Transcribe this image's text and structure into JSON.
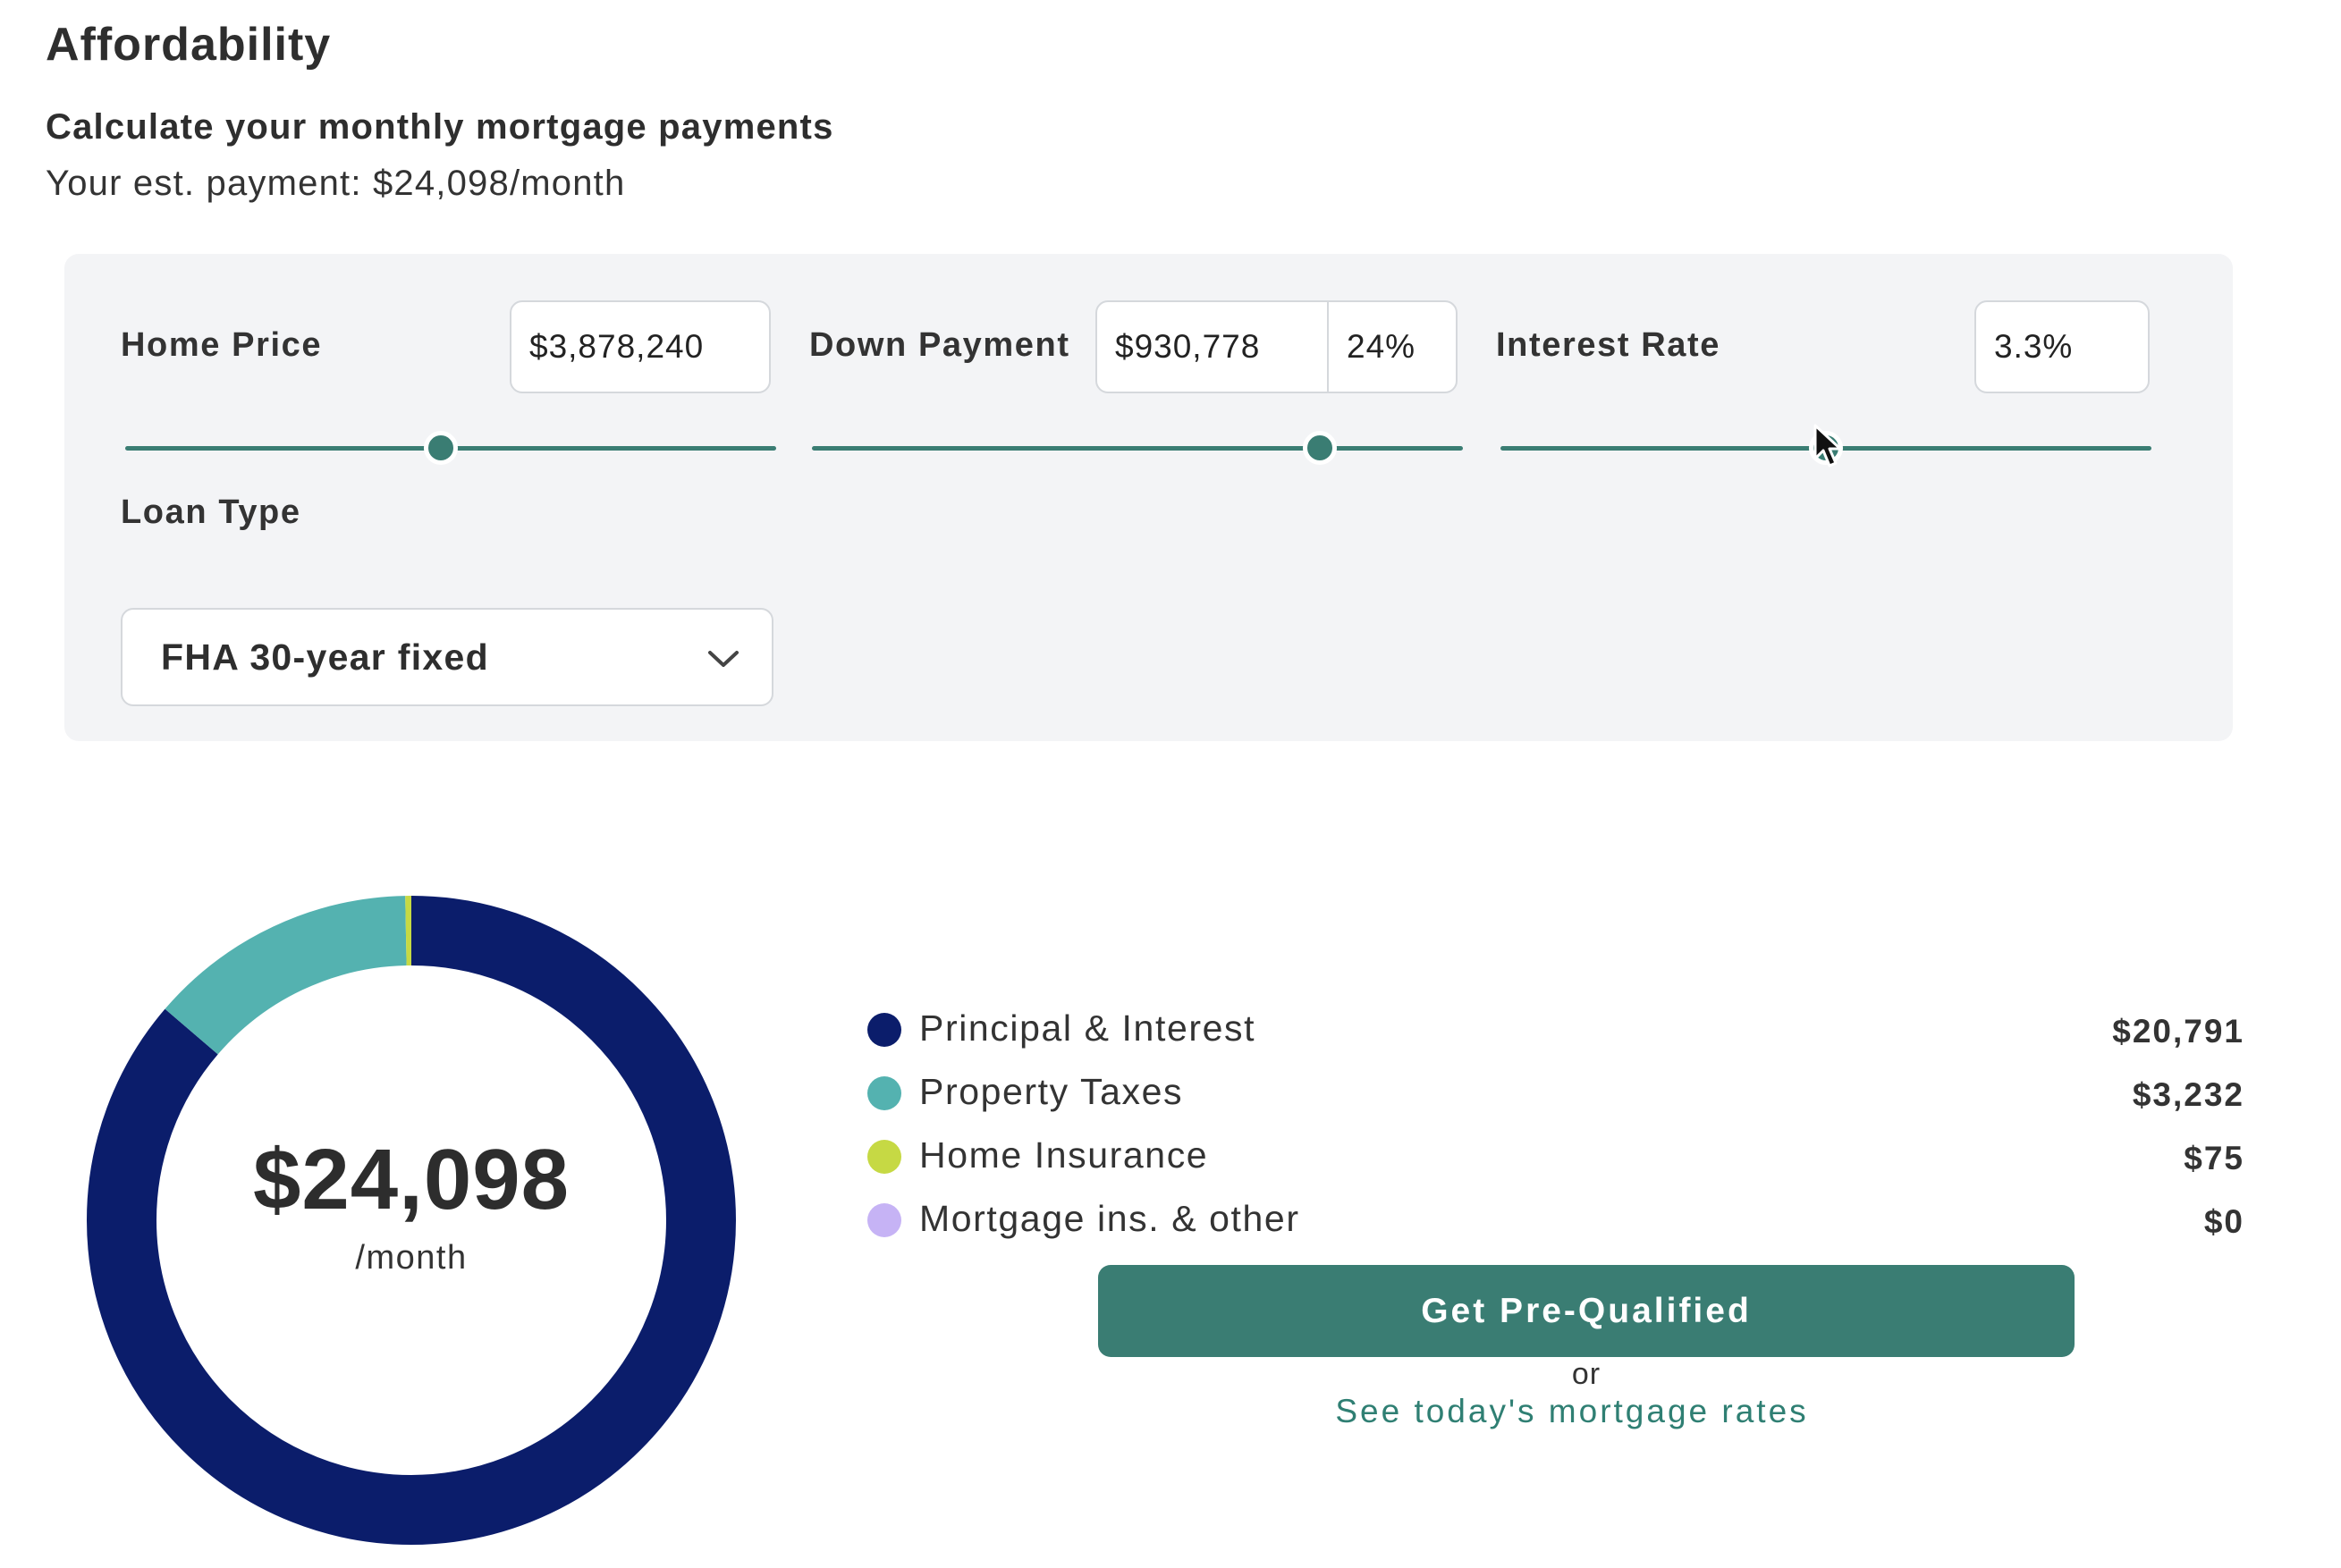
{
  "header": {
    "title": "Affordability",
    "subtitle": "Calculate your monthly mortgage payments",
    "estimate": "Your est. payment: $24,098/month"
  },
  "form": {
    "home_price": {
      "label": "Home Price",
      "value": "$3,878,240",
      "slider_fraction": 0.485
    },
    "down_payment": {
      "label": "Down Payment",
      "value": "$930,778",
      "percent": "24%",
      "slider_fraction": 0.78
    },
    "interest_rate": {
      "label": "Interest Rate",
      "value": "3.3%",
      "slider_fraction": 0.5
    },
    "loan_type": {
      "label": "Loan Type",
      "value": "FHA 30-year fixed",
      "icon": "chevron-down-icon"
    }
  },
  "summary": {
    "amount": "$24,098",
    "period": "/month"
  },
  "breakdown": [
    {
      "label": "Principal & Interest",
      "value": "$20,791",
      "amount": 20791,
      "color": "#0b1d6b"
    },
    {
      "label": "Property Taxes",
      "value": "$3,232",
      "amount": 3232,
      "color": "#54b2b0"
    },
    {
      "label": "Home Insurance",
      "value": "$75",
      "amount": 75,
      "color": "#c6d944"
    },
    {
      "label": "Mortgage ins. & other",
      "value": "$0",
      "amount": 0,
      "color": "#c6b3f5"
    }
  ],
  "actions": {
    "prequalify_label": "Get Pre-Qualified",
    "or_text": "or",
    "rates_link": "See today's mortgage rates"
  },
  "colors": {
    "accent": "#3a7d73",
    "panel_bg": "#f3f4f6"
  }
}
